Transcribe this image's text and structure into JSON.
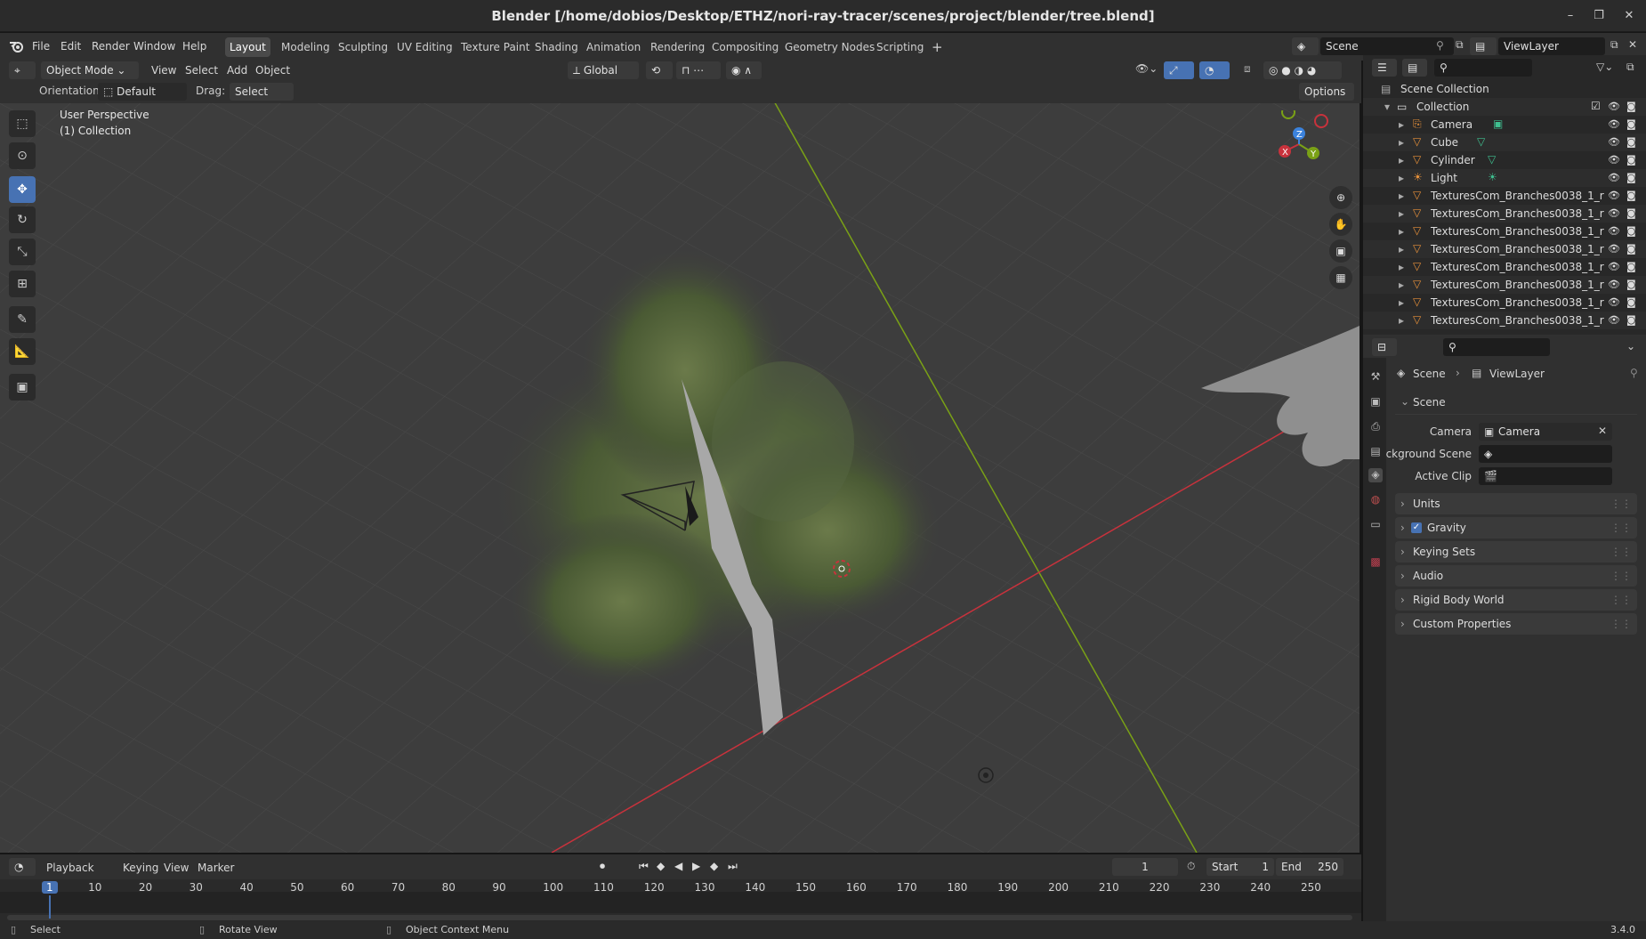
{
  "window": {
    "title": "Blender [/home/dobios/Desktop/ETHZ/nori-ray-tracer/scenes/project/blender/tree.blend]",
    "controls": [
      "–",
      "❐",
      "✕"
    ]
  },
  "menus": [
    "File",
    "Edit",
    "Render",
    "Window",
    "Help"
  ],
  "workspaces": [
    "Layout",
    "Modeling",
    "Sculpting",
    "UV Editing",
    "Texture Paint",
    "Shading",
    "Animation",
    "Rendering",
    "Compositing",
    "Geometry Nodes",
    "Scripting"
  ],
  "active_workspace": "Layout",
  "add_workspace": "+",
  "scene_field": "Scene",
  "viewlayer_field": "ViewLayer",
  "viewport_header": {
    "mode": "Object Mode",
    "menus": [
      "View",
      "Select",
      "Add",
      "Object"
    ],
    "transform": "Global",
    "orientation_label": "Orientation:",
    "orientation_value": "Default",
    "drag_label": "Drag:",
    "drag_value": "Select Box",
    "options": "Options"
  },
  "viewport": {
    "perspective": "User Perspective",
    "collection": "(1) Collection",
    "gizmo_axes": [
      "X",
      "Y",
      "Z"
    ]
  },
  "outliner": {
    "root": "Scene Collection",
    "collection": "Collection",
    "items": [
      {
        "name": "Camera",
        "type": "camera"
      },
      {
        "name": "Cube",
        "type": "mesh"
      },
      {
        "name": "Cylinder",
        "type": "mesh"
      },
      {
        "name": "Light",
        "type": "light"
      },
      {
        "name": "TexturesCom_Branches0038_1_r",
        "type": "mesh"
      },
      {
        "name": "TexturesCom_Branches0038_1_r",
        "type": "mesh"
      },
      {
        "name": "TexturesCom_Branches0038_1_r",
        "type": "mesh"
      },
      {
        "name": "TexturesCom_Branches0038_1_r",
        "type": "mesh"
      },
      {
        "name": "TexturesCom_Branches0038_1_r",
        "type": "mesh"
      },
      {
        "name": "TexturesCom_Branches0038_1_r",
        "type": "mesh"
      },
      {
        "name": "TexturesCom_Branches0038_1_r",
        "type": "mesh"
      },
      {
        "name": "TexturesCom_Branches0038_1_r",
        "type": "mesh"
      }
    ]
  },
  "properties": {
    "breadcrumb": [
      "Scene",
      "ViewLayer"
    ],
    "section": "Scene",
    "camera_label": "Camera",
    "camera_value": "Camera",
    "background_label": "Background Scene",
    "clip_label": "Active Clip",
    "panels": [
      "Units",
      "Gravity",
      "Keying Sets",
      "Audio",
      "Rigid Body World",
      "Custom Properties"
    ],
    "gravity_checked": true
  },
  "timeline": {
    "menus": [
      "Playback",
      "Keying",
      "View",
      "Marker"
    ],
    "current_frame": "1",
    "start_label": "Start",
    "start_value": "1",
    "end_label": "End",
    "end_value": "250",
    "ticks": [
      "1",
      "10",
      "20",
      "30",
      "40",
      "50",
      "60",
      "70",
      "80",
      "90",
      "100",
      "110",
      "120",
      "130",
      "140",
      "150",
      "160",
      "170",
      "180",
      "190",
      "200",
      "210",
      "220",
      "230",
      "240",
      "250"
    ]
  },
  "status": {
    "select": "Select",
    "rotate": "Rotate View",
    "context": "Object Context Menu",
    "version": "3.4.0"
  },
  "colors": {
    "accent": "#4772b3",
    "x_axis": "#c8323c",
    "y_axis": "#7aa116",
    "z_axis": "#3b82dc"
  }
}
